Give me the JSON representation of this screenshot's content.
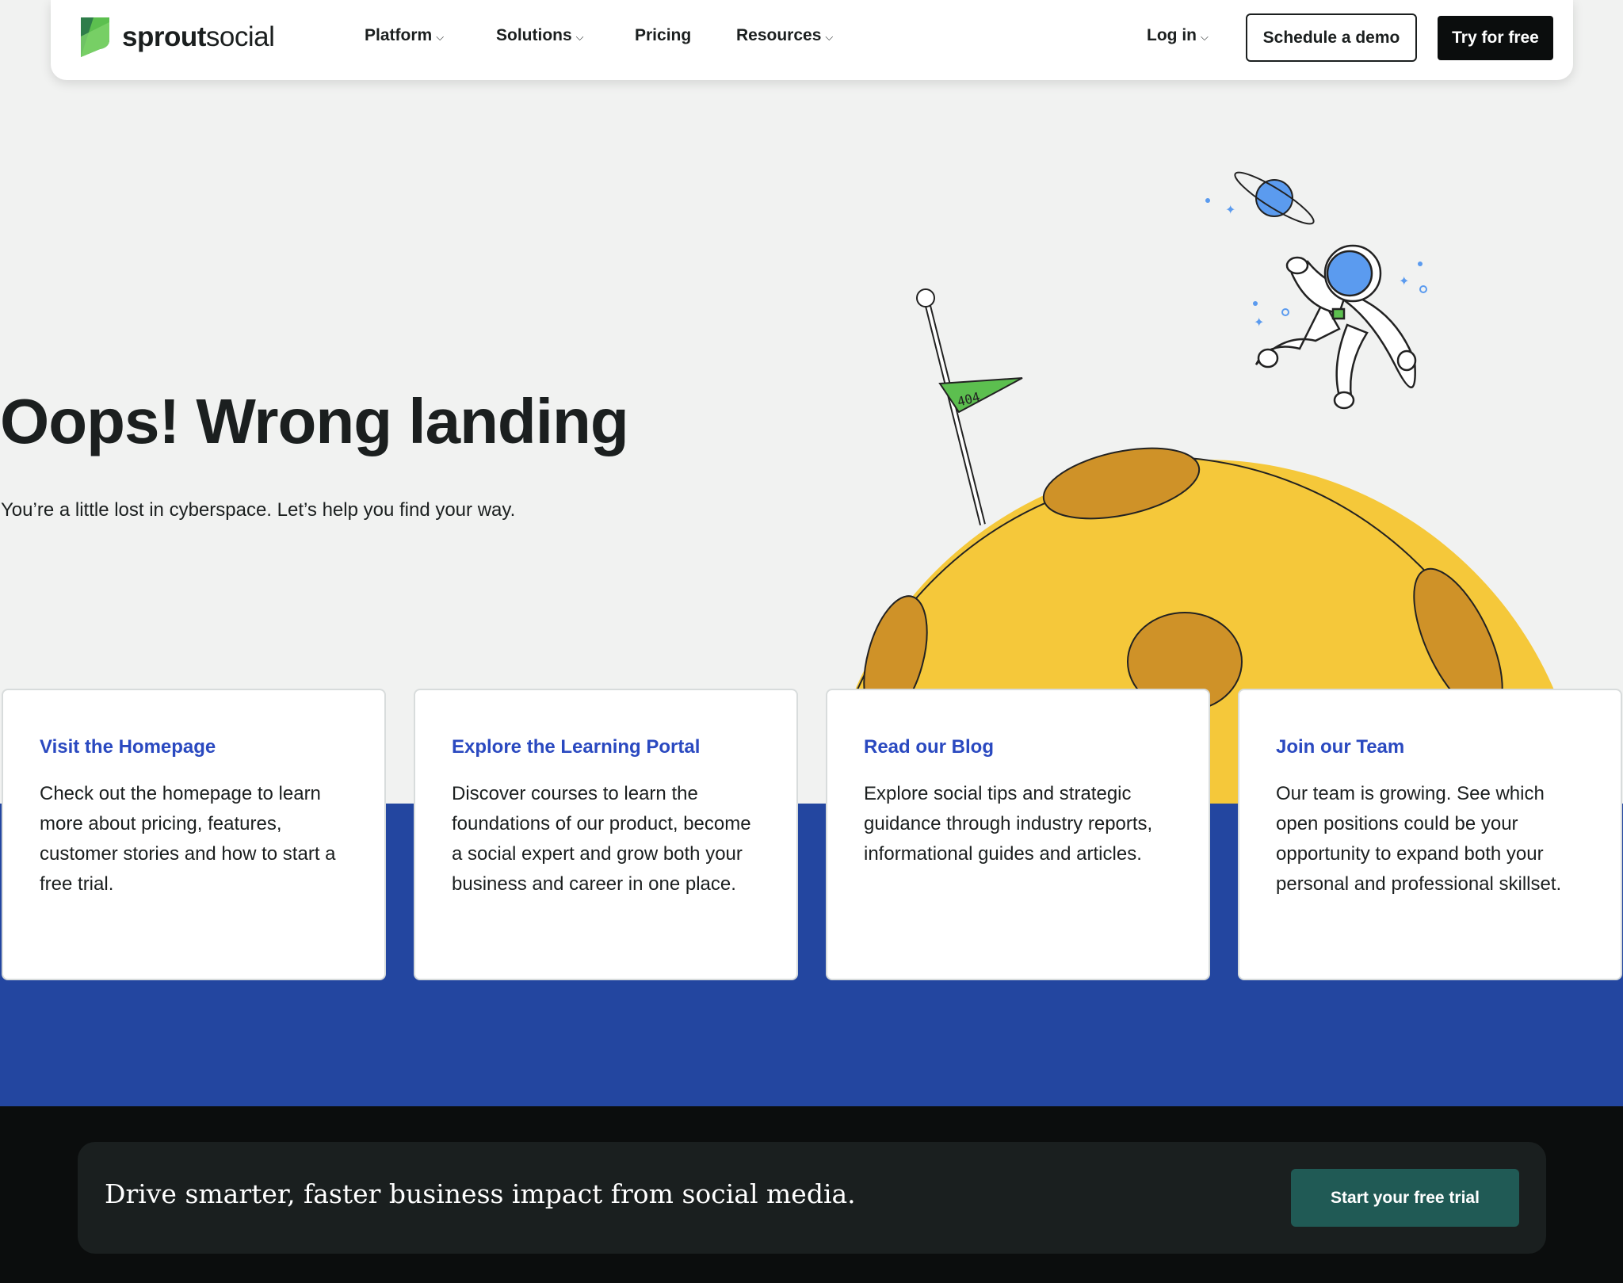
{
  "header": {
    "logo": {
      "bold": "sprout",
      "light": "social",
      "icon": "sprout-leaf-logo"
    },
    "nav": [
      {
        "label": "Platform",
        "dropdown": true
      },
      {
        "label": "Solutions",
        "dropdown": true
      },
      {
        "label": "Pricing",
        "dropdown": false
      },
      {
        "label": "Resources",
        "dropdown": true
      }
    ],
    "login": "Log in",
    "schedule_demo": "Schedule a demo",
    "try_free": "Try for free"
  },
  "hero": {
    "title": "Oops! Wrong landing",
    "subtitle": "You’re a little lost in cyberspace. Let’s help you find your way.",
    "flag_text": "404"
  },
  "cards": [
    {
      "title": "Visit the Homepage",
      "body": "Check out the homepage to learn more about pricing, features, customer stories and how to start a free trial."
    },
    {
      "title": "Explore the Learning Portal",
      "body": "Discover courses to learn the foundations of our product, become a social expert and grow both your business and career in one place."
    },
    {
      "title": "Read our Blog",
      "body": "Explore social tips and strategic guidance through industry reports, informational guides and articles."
    },
    {
      "title": "Join our Team",
      "body": "Our team is growing. See which open positions could be your opportunity to expand both your personal and professional skillset."
    }
  ],
  "footer": {
    "cta_text": "Drive smarter, faster business impact from social media.",
    "cta_button": "Start your free trial"
  },
  "colors": {
    "link_blue": "#2a49c0",
    "band_blue": "#2346a0",
    "moon": "#f5c83a",
    "crater": "#cf9228",
    "cta_green": "#205a55",
    "flag": "#5cbf4f"
  }
}
